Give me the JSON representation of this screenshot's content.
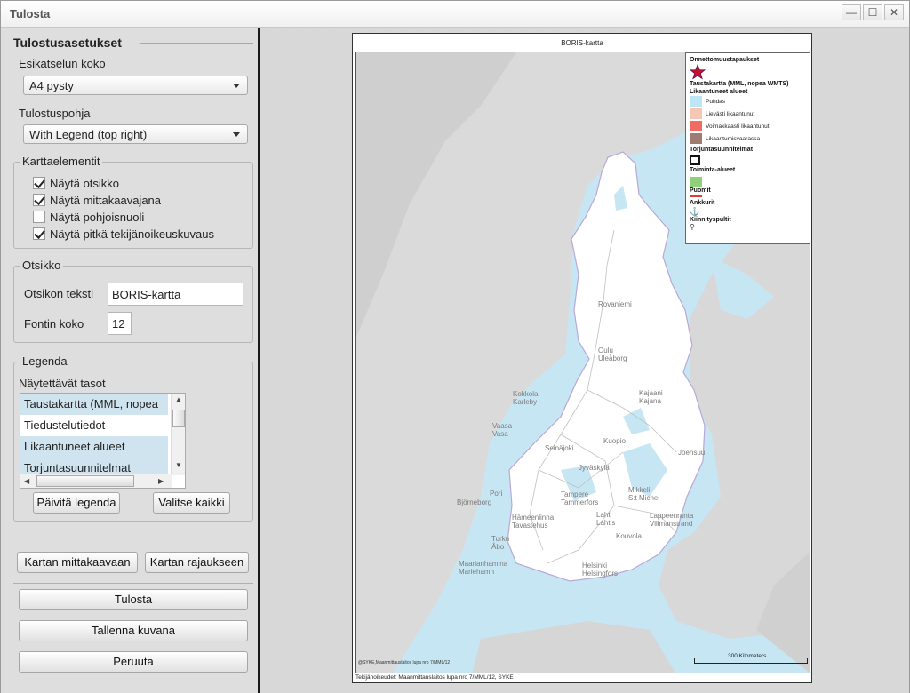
{
  "window": {
    "title": "Tulosta",
    "minimize": "—",
    "maximize": "☐",
    "close": "✕"
  },
  "settings": {
    "header": "Tulostusasetukset",
    "preview_size": {
      "label": "Esikatselun koko",
      "value": "A4 pysty"
    },
    "template": {
      "label": "Tulostuspohja",
      "value": "With Legend (top right)"
    },
    "map_elements": {
      "title": "Karttaelementit",
      "items": [
        {
          "label": "Näytä otsikko",
          "checked": true
        },
        {
          "label": "Näytä mittakaavajana",
          "checked": true
        },
        {
          "label": "Näytä pohjoisnuoli",
          "checked": false
        },
        {
          "label": "Näytä pitkä tekijänoikeuskuvaus",
          "checked": true
        }
      ]
    },
    "heading_group": {
      "title": "Otsikko",
      "text_label": "Otsikon teksti",
      "text_value": "BORIS-kartta",
      "font_label": "Fontin koko",
      "font_value": "12"
    },
    "legend_group": {
      "title": "Legenda",
      "layers_label": "Näytettävät tasot",
      "layers": [
        {
          "label": "Taustakartta (MML, nopea",
          "selected": true
        },
        {
          "label": "Tiedustelutiedot",
          "selected": false
        },
        {
          "label": "Likaantuneet alueet",
          "selected": true
        },
        {
          "label": "Torjuntasuunnitelmat",
          "selected": true
        }
      ],
      "refresh_button": "Päivitä legenda",
      "select_all_button": "Valitse kaikki"
    },
    "map_scale_button": "Kartan mittakaavaan",
    "map_extent_button": "Kartan rajaukseen",
    "print_button": "Tulosta",
    "save_image_button": "Tallenna kuvana",
    "cancel_button": "Peruuta"
  },
  "preview": {
    "map_title": "BORIS-kartta",
    "legend": {
      "accidents": "Onnettomuustapaukset",
      "basemap": "Taustakartta (MML, nopea WMTS)",
      "polluted": "Likaantuneet alueet",
      "polluted_items": [
        {
          "label": "Puhdas",
          "color": "#bfe6f7"
        },
        {
          "label": "Lievästi likaantunut",
          "color": "#f7c7b6"
        },
        {
          "label": "Voimakkaasti likaantunut",
          "color": "#f26b62"
        },
        {
          "label": "Likaantumisvaarassa",
          "color": "#a07b74"
        }
      ],
      "plans": "Torjuntasuunnitelmat",
      "operation_areas": "Toiminta-alueet",
      "operation_color": "#8ed17a",
      "booms": "Puomit",
      "boom_color": "#e03a3a",
      "anchors": "Ankkurit",
      "bolts": "Kiinnityspultit"
    },
    "cities": [
      "Rovaniemi",
      "Oulu",
      "Uleåborg",
      "Kokkola",
      "Karleby",
      "Kajaani",
      "Kajana",
      "Vaasa",
      "Vasa",
      "Seinäjoki",
      "Kuopio",
      "Joensuu",
      "Jyväskylä",
      "Pori",
      "Björneborg",
      "Tampere",
      "Tammerfors",
      "Mikkeli",
      "S:t Michel",
      "Hämeenlinna",
      "Tavastehus",
      "Lahti",
      "Lahtis",
      "Lappeenranta",
      "Villmanstrand",
      "Turku",
      "Åbo",
      "Kouvola",
      "Maarianhamina",
      "Mariehamn",
      "Helsinki",
      "Helsingfors"
    ],
    "scale_label": "300 Kilometers",
    "attribution_small": "@SYKE,Maanmittauslaitos lupa nro 7/MML/12",
    "attribution": "Tekijänoikeudet: Maanmittauslaitos lupa nro 7/MML/12, SYKE"
  }
}
